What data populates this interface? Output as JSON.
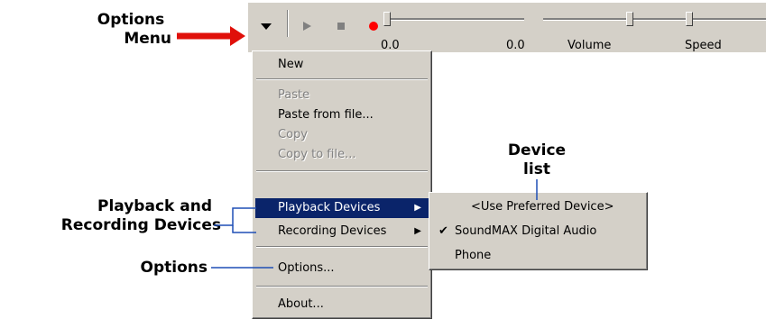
{
  "annotations": {
    "options_menu_line1": "Options",
    "options_menu_line2": "Menu",
    "device_list_line1": "Device",
    "device_list_line2": "list",
    "playback_recording_line1": "Playback and",
    "playback_recording_line2": "Recording Devices",
    "options": "Options"
  },
  "toolbar": {
    "position_start": "0.0",
    "position_end": "0.0",
    "volume_label": "Volume",
    "speed_label": "Speed",
    "dropdown_icon": "triangle-down-icon",
    "play_icon": "play-icon",
    "stop_icon": "stop-icon",
    "record_icon": "record-icon"
  },
  "menu": {
    "new": "New",
    "paste": "Paste",
    "paste_from_file": "Paste from file...",
    "copy": "Copy",
    "copy_to_file": "Copy to file...",
    "playback_devices": "Playback Devices",
    "recording_devices": "Recording Devices",
    "options": "Options...",
    "about": "About..."
  },
  "submenu": {
    "preferred": "<Use Preferred Device>",
    "soundmax": "SoundMAX Digital Audio",
    "phone": "Phone"
  },
  "colors": {
    "annotation_arrow": "#e0100a",
    "annotation_lines": "#1f4fb5",
    "menu_face": "#d4d0c8",
    "selection": "#0a246a"
  }
}
